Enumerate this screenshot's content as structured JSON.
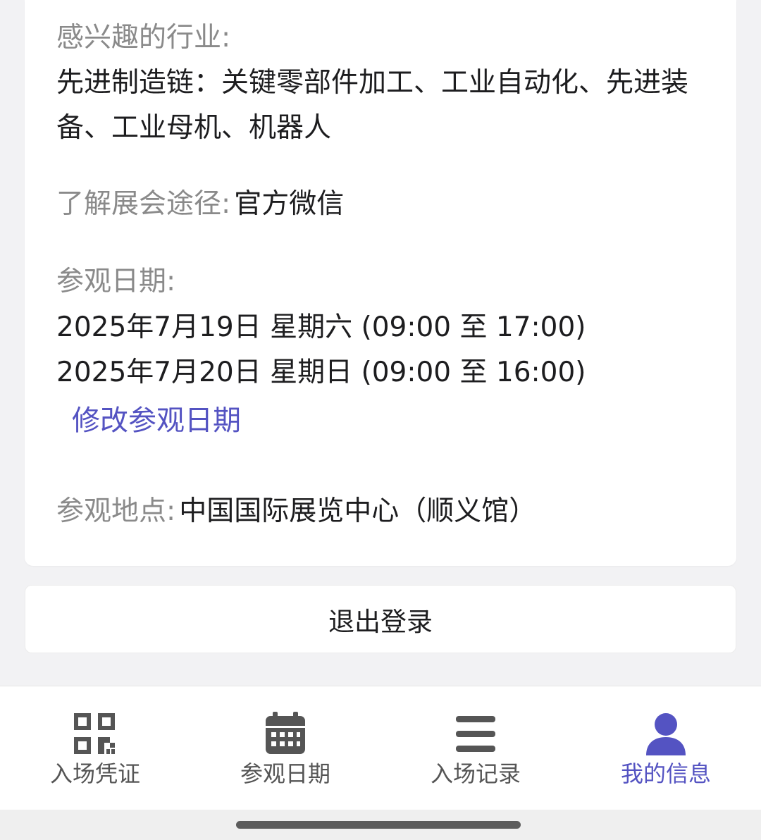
{
  "info": {
    "industry_label": "感兴趣的行业:",
    "industry_value": "先进制造链：关键零部件加工、工业自动化、先进装备、工业母机、机器人",
    "channel_label": "了解展会途径:",
    "channel_value": "官方微信",
    "date_label": "参观日期:",
    "dates": [
      "2025年7月19日 星期六 (09:00 至 17:00)",
      "2025年7月20日 星期日 (09:00 至 16:00)"
    ],
    "modify_date_link": "修改参观日期",
    "venue_label": "参观地点:",
    "venue_value": "中国国际展览中心（顺义馆）"
  },
  "logout_label": "退出登录",
  "bottom_nav": {
    "items": [
      {
        "label": "入场凭证",
        "icon": "qr-code-icon",
        "active": false
      },
      {
        "label": "参观日期",
        "icon": "calendar-icon",
        "active": false
      },
      {
        "label": "入场记录",
        "icon": "list-icon",
        "active": false
      },
      {
        "label": "我的信息",
        "icon": "user-icon",
        "active": true
      }
    ]
  },
  "colors": {
    "accent": "#5453c2",
    "nav_inactive": "#555555",
    "label_gray": "#8a8a8a",
    "text_dark": "#1d1d1f"
  }
}
